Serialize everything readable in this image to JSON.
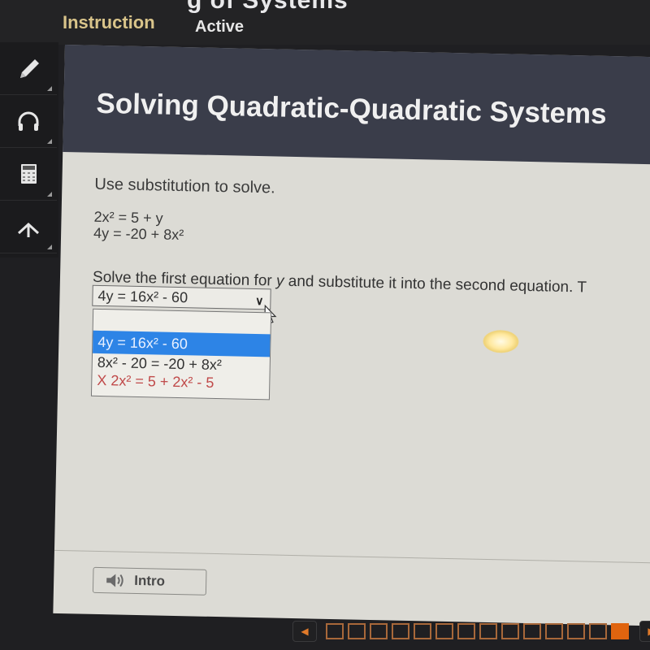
{
  "topbar": {
    "title": "g of Systems",
    "tabs": [
      {
        "label": "Instruction",
        "active": true
      },
      {
        "label": "Active",
        "active": false
      }
    ]
  },
  "toolbar": {
    "tools": [
      {
        "icon": "pencil-icon"
      },
      {
        "icon": "headphones-icon"
      },
      {
        "icon": "calculator-icon"
      },
      {
        "icon": "arrow-up-icon"
      }
    ]
  },
  "header": {
    "page_title": "Solving Quadratic-Quadratic Systems"
  },
  "question": {
    "instruction": "Use substitution to solve.",
    "equations": [
      "2x² = 5 + y",
      "4y = -20 + 8x²"
    ],
    "prompt_before": "Solve the first equation for ",
    "prompt_var": "y",
    "prompt_after": " and substitute it into the second equation. T",
    "select": {
      "value": "4y = 16x² - 60",
      "options": [
        {
          "label": "4y = 16x² - 60",
          "state": "highlighted"
        },
        {
          "label": "8x² - 20 = -20 + 8x²",
          "state": "normal"
        },
        {
          "label": "X 2x² = 5 + 2x² - 5",
          "state": "incorrect"
        }
      ]
    }
  },
  "footer": {
    "intro_label": "Intro"
  },
  "pagination": {
    "total_pages": 14,
    "current_page": 14
  },
  "colors": {
    "accent_orange": "#e0640f",
    "tab_active": "#d9c48a",
    "highlight_blue": "#2d84e6",
    "incorrect_red": "#c04a4a",
    "header_bg": "#3a3d4a"
  }
}
